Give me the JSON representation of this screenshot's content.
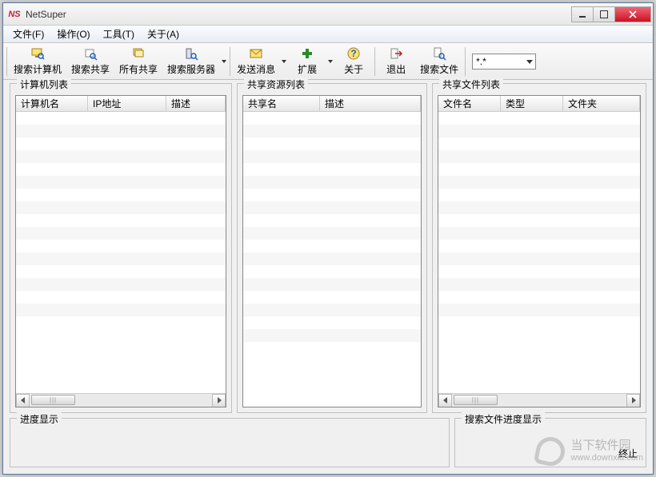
{
  "window": {
    "title": "NetSuper"
  },
  "menu": {
    "file": "文件(F)",
    "operate": "操作(O)",
    "tools": "工具(T)",
    "about": "关于(A)"
  },
  "toolbar": {
    "search_computer": "搜索计算机",
    "search_share": "搜索共享",
    "all_share": "所有共享",
    "search_server": "搜索服务器",
    "send_message": "发送消息",
    "extend": "扩展",
    "about": "关于",
    "exit": "退出",
    "search_file": "搜索文件",
    "filter_value": "*.*"
  },
  "panels": {
    "computer_list": {
      "title": "计算机列表",
      "cols": {
        "name": "计算机名",
        "ip": "IP地址",
        "desc": "描述"
      }
    },
    "share_list": {
      "title": "共享资源列表",
      "cols": {
        "name": "共享名",
        "desc": "描述"
      }
    },
    "file_list": {
      "title": "共享文件列表",
      "cols": {
        "name": "文件名",
        "type": "类型",
        "folder": "文件夹"
      }
    }
  },
  "progress": {
    "title": "进度显示",
    "search_title": "搜索文件进度显示",
    "stop": "终止"
  },
  "watermark": {
    "line1": "当下软件园",
    "line2": "www.downxia.com"
  }
}
